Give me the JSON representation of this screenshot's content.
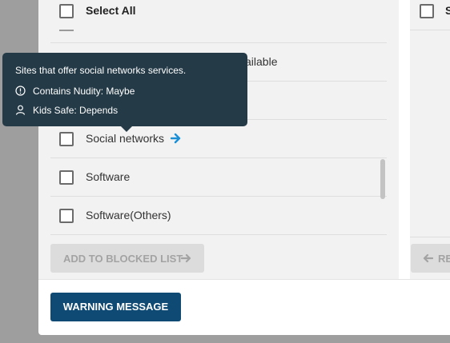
{
  "header": {
    "select_all_label": "Select All"
  },
  "list": {
    "items": [
      {
        "label": ""
      },
      {
        "label": "ailable"
      },
      {
        "label": ""
      },
      {
        "label": "Social networks"
      },
      {
        "label": "Software"
      },
      {
        "label": "Software(Others)"
      }
    ]
  },
  "tooltip": {
    "description": "Sites that offer social networks services.",
    "nudity": "Contains Nudity: Maybe",
    "kids_safe": "Kids Safe: Depends"
  },
  "buttons": {
    "add_to_blocked": "ADD TO BLOCKED LIST",
    "remove": "RE",
    "warning_message": "WARNING MESSAGE"
  },
  "right_panel": {
    "header_label": "S"
  },
  "colors": {
    "primary": "#0e4a73",
    "tooltip_bg": "#243a47",
    "arrow_blue": "#1a8fd6",
    "panel_bg": "#f2f2f2"
  }
}
